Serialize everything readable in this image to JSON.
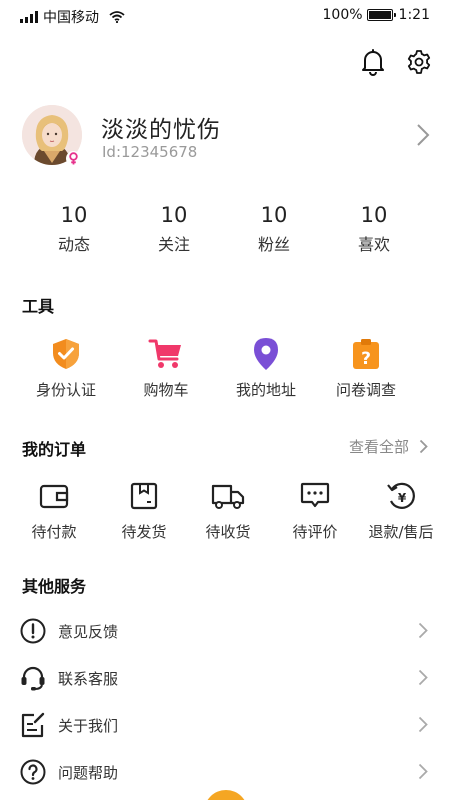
{
  "status_bar": {
    "carrier": "中国移动",
    "battery": "100%",
    "time": "1:21",
    "battery_level": 1.0
  },
  "header": {
    "notification_icon": "bell-icon",
    "settings_icon": "gear-icon"
  },
  "profile": {
    "name": "淡淡的忧伤",
    "id_text": "Id:12345678",
    "gender_icon": "female-icon",
    "gender_color": "#e6338c"
  },
  "stats": [
    {
      "value": "10",
      "label": "动态"
    },
    {
      "value": "10",
      "label": "关注"
    },
    {
      "value": "10",
      "label": "粉丝"
    },
    {
      "value": "10",
      "label": "喜欢"
    }
  ],
  "tools": {
    "title": "工具",
    "items": [
      {
        "label": "身份认证",
        "icon": "shield-check-icon",
        "color": "#f28c1e"
      },
      {
        "label": "购物车",
        "icon": "shopping-cart-icon",
        "color": "#f0386a"
      },
      {
        "label": "我的地址",
        "icon": "location-pin-icon",
        "color": "#7a4fd6"
      },
      {
        "label": "问卷调查",
        "icon": "clipboard-question-icon",
        "color": "#f7941d"
      }
    ]
  },
  "orders": {
    "title": "我的订单",
    "view_all": "查看全部",
    "items": [
      {
        "label": "待付款",
        "icon": "wallet-icon"
      },
      {
        "label": "待发货",
        "icon": "package-icon"
      },
      {
        "label": "待收货",
        "icon": "truck-icon"
      },
      {
        "label": "待评价",
        "icon": "comment-icon"
      },
      {
        "label": "退款/售后",
        "icon": "refund-icon"
      }
    ]
  },
  "services": {
    "title": "其他服务",
    "items": [
      {
        "label": "意见反馈",
        "icon": "exclamation-circle-icon"
      },
      {
        "label": "联系客服",
        "icon": "headset-icon"
      },
      {
        "label": "关于我们",
        "icon": "edit-note-icon"
      },
      {
        "label": "问题帮助",
        "icon": "question-circle-icon"
      }
    ]
  },
  "colors": {
    "accent": "#f5a623",
    "text_primary": "#222222",
    "text_secondary": "#9a9a9a"
  }
}
